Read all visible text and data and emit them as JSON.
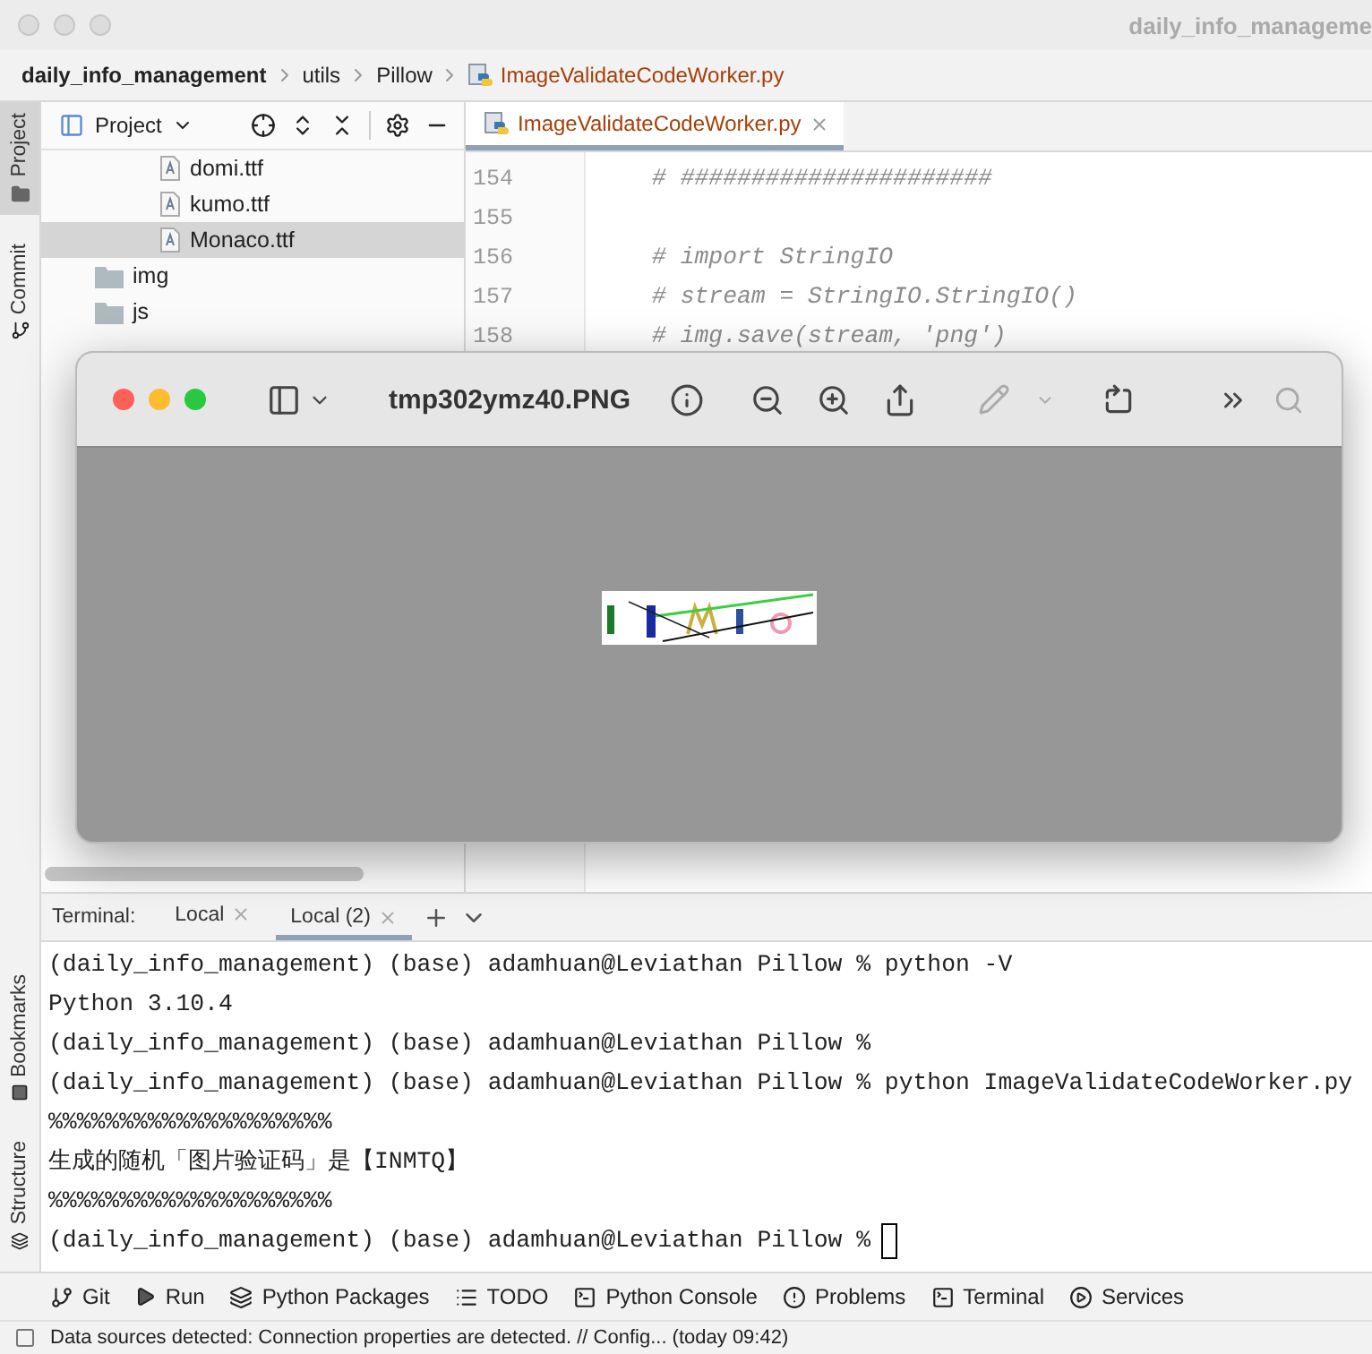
{
  "window": {
    "title": "daily_info_manageme"
  },
  "breadcrumbs": [
    {
      "label": "daily_info_management",
      "kind": "project"
    },
    {
      "label": "utils",
      "kind": "folder"
    },
    {
      "label": "Pillow",
      "kind": "folder"
    },
    {
      "label": "ImageValidateCodeWorker.py",
      "kind": "file"
    }
  ],
  "left_strip_top": [
    {
      "label": "Project",
      "selected": true
    },
    {
      "label": "Commit",
      "selected": false
    }
  ],
  "left_strip_bottom": [
    {
      "label": "Bookmarks"
    },
    {
      "label": "Structure"
    }
  ],
  "project_panel": {
    "title": "Project",
    "tree": [
      {
        "kind": "hidden_parent",
        "children": [
          {
            "name": "domi.ttf",
            "kind": "font",
            "selected": false
          },
          {
            "name": "kumo.ttf",
            "kind": "font",
            "selected": false
          },
          {
            "name": "Monaco.ttf",
            "kind": "font",
            "selected": true
          }
        ]
      },
      {
        "name": "img",
        "kind": "folder",
        "selected": false
      },
      {
        "name": "js",
        "kind": "folder",
        "selected": false
      }
    ]
  },
  "editor": {
    "tabs": [
      {
        "label": "ImageValidateCodeWorker.py",
        "selected": true
      }
    ],
    "lines": [
      {
        "number": "154",
        "code": "# ######################"
      },
      {
        "number": "155"
      },
      {
        "number": "156",
        "code": "# import StringIO"
      },
      {
        "number": "157",
        "code": "# stream = StringIO.StringIO()"
      },
      {
        "number": "158",
        "code": "# img.save(stream, 'png')"
      }
    ]
  },
  "preview": {
    "title": "tmp302ymz40.PNG"
  },
  "terminal": {
    "label": "Terminal:",
    "tabs": [
      {
        "label": "Local",
        "selected": false
      },
      {
        "label": "Local (2)",
        "selected": true
      }
    ],
    "lines": [
      "(daily_info_management) (base) adamhuan@Leviathan Pillow % python -V",
      "Python 3.10.4",
      "(daily_info_management) (base) adamhuan@Leviathan Pillow %",
      "(daily_info_management) (base) adamhuan@Leviathan Pillow % python ImageValidateCodeWorker.py",
      "%%%%%%%%%%%%%%%%%%%%",
      "生成的随机「图片验证码」是【INMTQ】",
      "%%%%%%%%%%%%%%%%%%%%",
      "(daily_info_management) (base) adamhuan@Leviathan Pillow %"
    ],
    "cursor": true
  },
  "tool_windows": [
    {
      "label": "Git",
      "kind": "git"
    },
    {
      "label": "Run",
      "kind": "run"
    },
    {
      "label": "Python Packages",
      "kind": "packages"
    },
    {
      "label": "TODO",
      "kind": "todo"
    },
    {
      "label": "Python Console",
      "kind": "console"
    },
    {
      "label": "Problems",
      "kind": "problems"
    },
    {
      "label": "Terminal",
      "kind": "terminal"
    },
    {
      "label": "Services",
      "kind": "services"
    }
  ],
  "status_bar": {
    "message": "Data sources detected: Connection properties are detected. // Config... (today 09:42)"
  }
}
